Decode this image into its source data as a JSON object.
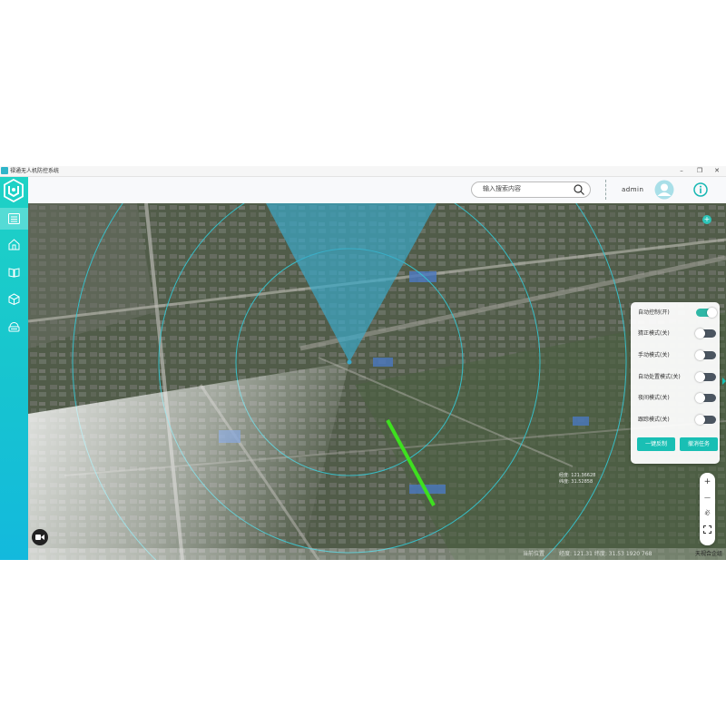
{
  "window": {
    "title": "禄通无人机防控系统",
    "buttons": [
      "–",
      "❐",
      "✕"
    ]
  },
  "sidebar": {
    "items": [
      {
        "icon": "list-icon",
        "active": true
      },
      {
        "icon": "home-shield-icon",
        "active": false
      },
      {
        "icon": "book-icon",
        "active": false
      },
      {
        "icon": "cube-icon",
        "active": false
      },
      {
        "icon": "device-icon",
        "active": false
      }
    ]
  },
  "header": {
    "search_placeholder": "输入搜索内容",
    "username": "admin"
  },
  "panel": {
    "modes": [
      {
        "label": "自动控制(开)",
        "on": true
      },
      {
        "label": "猜正模式(关)",
        "on": false
      },
      {
        "label": "手动模式(关)",
        "on": false
      },
      {
        "label": "自动处置模式(关)",
        "on": false
      },
      {
        "label": "夜间模式(关)",
        "on": false
      },
      {
        "label": "跟踪模式(关)",
        "on": false
      }
    ],
    "btn_counter": "一键反制",
    "btn_withdraw": "撤消任务"
  },
  "map": {
    "zoom_in": "+",
    "zoom_out": "—",
    "zoom_level": "必",
    "track_readout_1": "经度: 121.36628",
    "track_readout_2": "纬度: 31.52858",
    "status_left": "当前位置",
    "status_mid": "经度: 121.31  纬度: 31.53  1920  768",
    "copyright": "天视合企组"
  },
  "colors": {
    "accent": "#19bfb4",
    "radar_sector": "#3aa8c8",
    "track": "#3ee01f"
  }
}
